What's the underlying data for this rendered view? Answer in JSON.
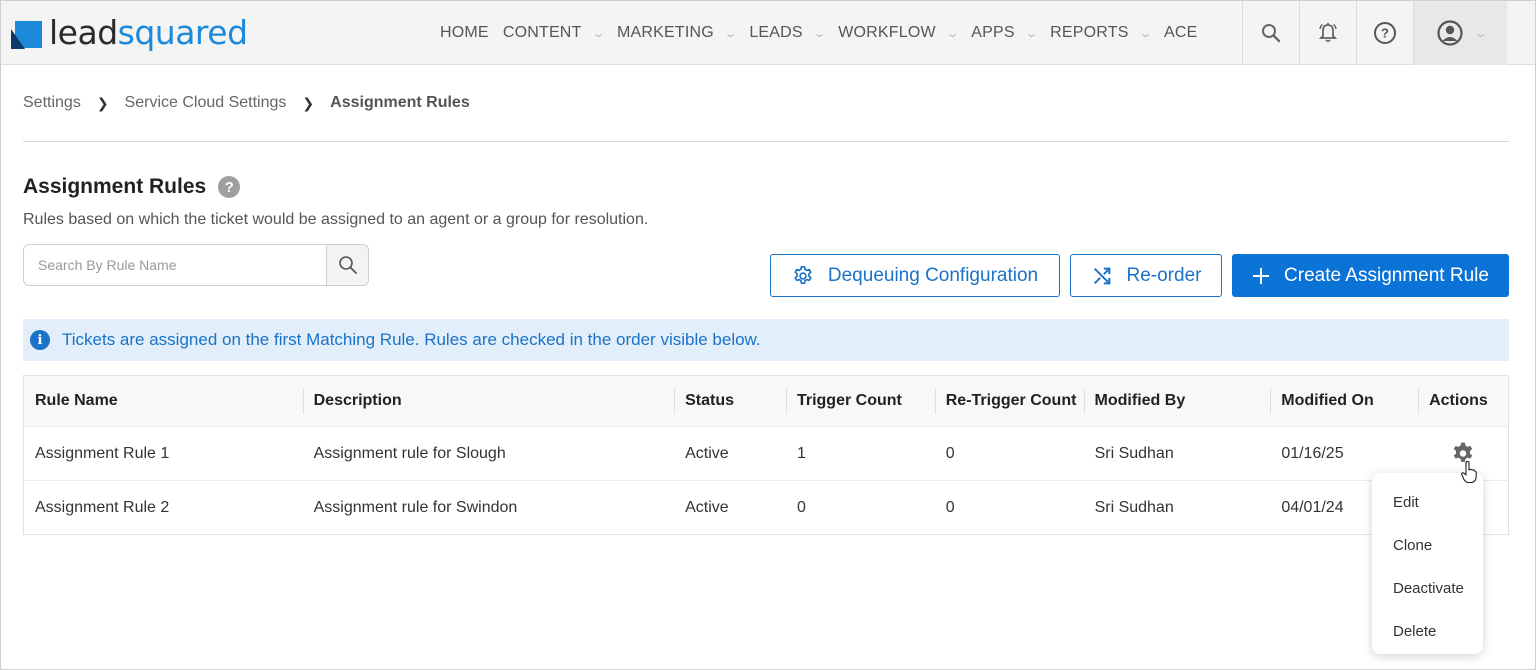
{
  "brand": {
    "logo_part1": "lead",
    "logo_part2": "squared",
    "accent": "#1c8ad9"
  },
  "nav": {
    "items": [
      {
        "label": "HOME",
        "has_menu": false
      },
      {
        "label": "CONTENT",
        "has_menu": true
      },
      {
        "label": "MARKETING",
        "has_menu": true
      },
      {
        "label": "LEADS",
        "has_menu": true
      },
      {
        "label": "WORKFLOW",
        "has_menu": true
      },
      {
        "label": "APPS",
        "has_menu": true
      },
      {
        "label": "REPORTS",
        "has_menu": true
      },
      {
        "label": "ACE",
        "has_menu": false
      }
    ],
    "icons": [
      "search-icon",
      "bell-icon",
      "help-icon",
      "user-profile-icon"
    ]
  },
  "breadcrumb": {
    "items": [
      "Settings",
      "Service Cloud Settings",
      "Assignment Rules"
    ]
  },
  "page": {
    "title": "Assignment Rules",
    "help_glyph": "?",
    "subtitle": "Rules based on which the ticket would be assigned to an agent or a group for resolution."
  },
  "search": {
    "placeholder": "Search By Rule Name",
    "value": ""
  },
  "actions": {
    "dequeue_label": "Dequeuing Configuration",
    "reorder_label": "Re-order",
    "create_label": "Create Assignment Rule",
    "primary_color": "#0c73d6"
  },
  "info_banner": {
    "text": "Tickets are assigned on the first Matching Rule. Rules are checked in the order visible below."
  },
  "table": {
    "columns": [
      "Rule Name",
      "Description",
      "Status",
      "Trigger Count",
      "Re-Trigger Count",
      "Modified By",
      "Modified On",
      "Actions"
    ],
    "rows": [
      {
        "rule_name": "Assignment Rule 1",
        "description": "Assignment rule for Slough",
        "status": "Active",
        "trigger_count": "1",
        "retrigger_count": "0",
        "modified_by": "Sri Sudhan",
        "modified_on": "01/16/25"
      },
      {
        "rule_name": "Assignment Rule 2",
        "description": "Assignment rule for Swindon",
        "status": "Active",
        "trigger_count": "0",
        "retrigger_count": "0",
        "modified_by": "Sri Sudhan",
        "modified_on": "04/01/24"
      }
    ]
  },
  "actions_menu": {
    "items": [
      "Edit",
      "Clone",
      "Deactivate",
      "Delete"
    ]
  }
}
